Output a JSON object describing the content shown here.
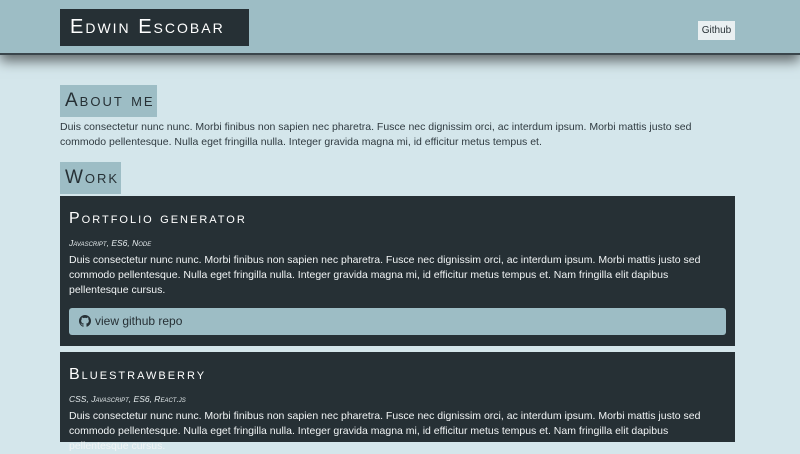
{
  "header": {
    "brand": "Edwin Escobar",
    "github_link": "Github"
  },
  "about": {
    "title": "About me",
    "text": "Duis consectetur nunc nunc. Morbi finibus non sapien nec pharetra. Fusce nec dignissim orci, ac interdum ipsum. Morbi mattis justo sed commodo pellentesque. Nulla eget fringilla nulla. Integer gravida magna mi, id efficitur metus tempus et."
  },
  "work": {
    "title": "Work",
    "projects": [
      {
        "title": "Portfolio generator",
        "tech": "Javascript, ES6, Node",
        "description": "Duis consectetur nunc nunc. Morbi finibus non sapien nec pharetra. Fusce nec dignissim orci, ac interdum ipsum. Morbi mattis justo sed commodo pellentesque. Nulla eget fringilla nulla. Integer gravida magna mi, id efficitur metus tempus et. Nam fringilla elit dapibus pellentesque cursus.",
        "repo_label": "view github repo",
        "repo_icon": "github-icon"
      },
      {
        "title": "Bluestrawberry",
        "tech": "CSS, Javascript, ES6, React.js",
        "description": "Duis consectetur nunc nunc. Morbi finibus non sapien nec pharetra. Fusce nec dignissim orci, ac interdum ipsum. Morbi mattis justo sed commodo pellentesque. Nulla eget fringilla nulla. Integer gravida magna mi, id efficitur metus tempus et. Nam fringilla elit dapibus pellentesque cursus."
      }
    ]
  },
  "colors": {
    "page_background": "#d4e6eb",
    "accent": "#9dbdc5",
    "dark": "#263035"
  }
}
